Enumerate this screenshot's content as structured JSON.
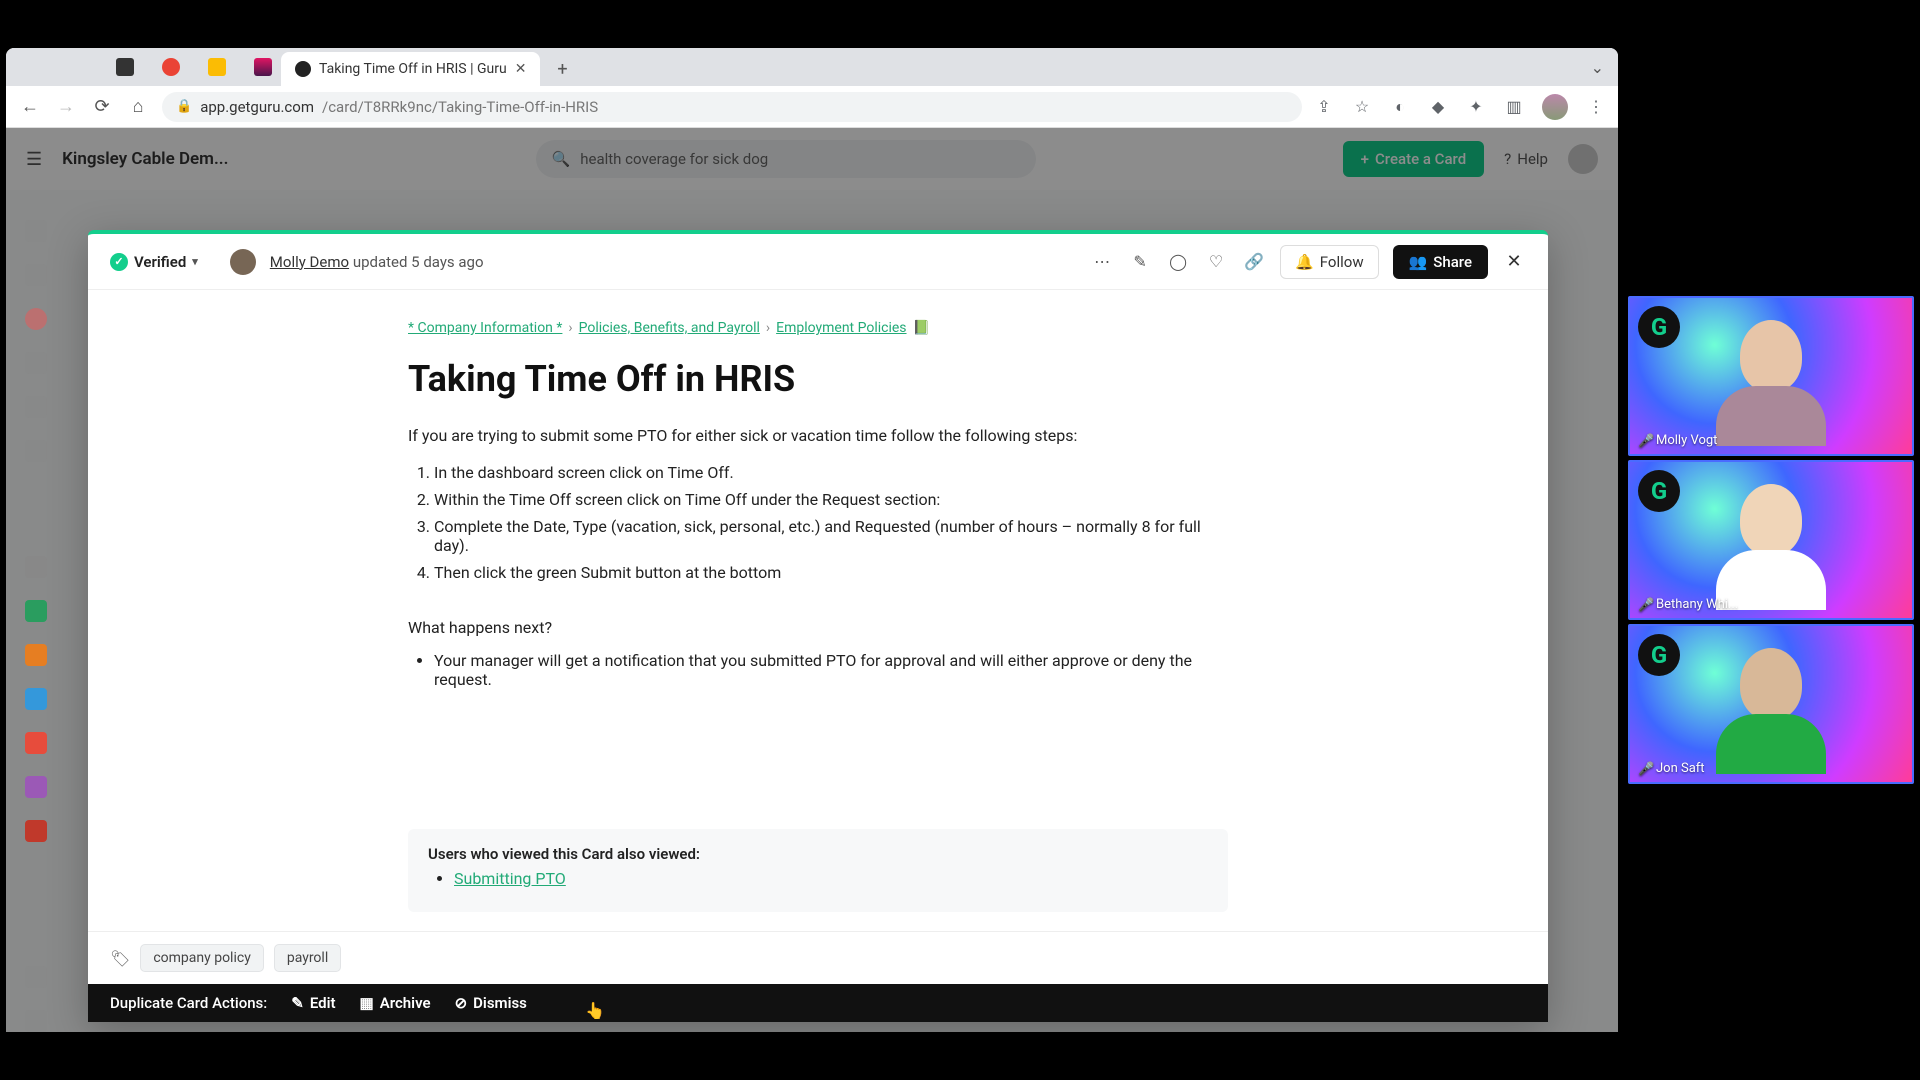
{
  "browser": {
    "tab_title": "Taking Time Off in HRIS | Guru",
    "url_host": "app.getguru.com",
    "url_path": "/card/T8RRk9nc/Taking-Time-Off-in-HRIS"
  },
  "app": {
    "workspace": "Kingsley Cable Dem...",
    "search_value": "health coverage for sick dog",
    "create_label": "Create a Card",
    "help_label": "Help"
  },
  "card": {
    "verified_label": "Verified",
    "author": "Molly Demo",
    "updated": "updated 5 days ago",
    "follow_label": "Follow",
    "share_label": "Share",
    "breadcrumb": [
      "* Company Information *",
      "Policies, Benefits, and Payroll",
      "Employment Policies"
    ],
    "breadcrumb_emoji": "📗",
    "title": "Taking Time Off in HRIS",
    "intro": "If you are trying to submit some PTO for either sick or vacation time follow the following steps:",
    "steps": [
      "In the dashboard screen click on Time Off.",
      "Within the Time Off screen click on Time Off under the Request section:",
      "Complete the Date, Type (vacation, sick, personal, etc.) and Requested (number of hours – normally 8 for full day).",
      "Then click the green Submit button at the bottom"
    ],
    "next_heading": "What happens next?",
    "next_bullets": [
      "Your manager will get a notification that you submitted PTO for approval and will either approve or deny the request."
    ],
    "related_heading": "Users who viewed this Card also viewed:",
    "related_links": [
      "Submitting PTO"
    ],
    "tags": [
      "company policy",
      "payroll"
    ]
  },
  "dup_bar": {
    "label": "Duplicate Card Actions:",
    "edit": "Edit",
    "archive": "Archive",
    "dismiss": "Dismiss"
  },
  "video": {
    "p1": "Molly Vogt",
    "p2": "Bethany Whi...",
    "p3": "Jon Saft"
  }
}
